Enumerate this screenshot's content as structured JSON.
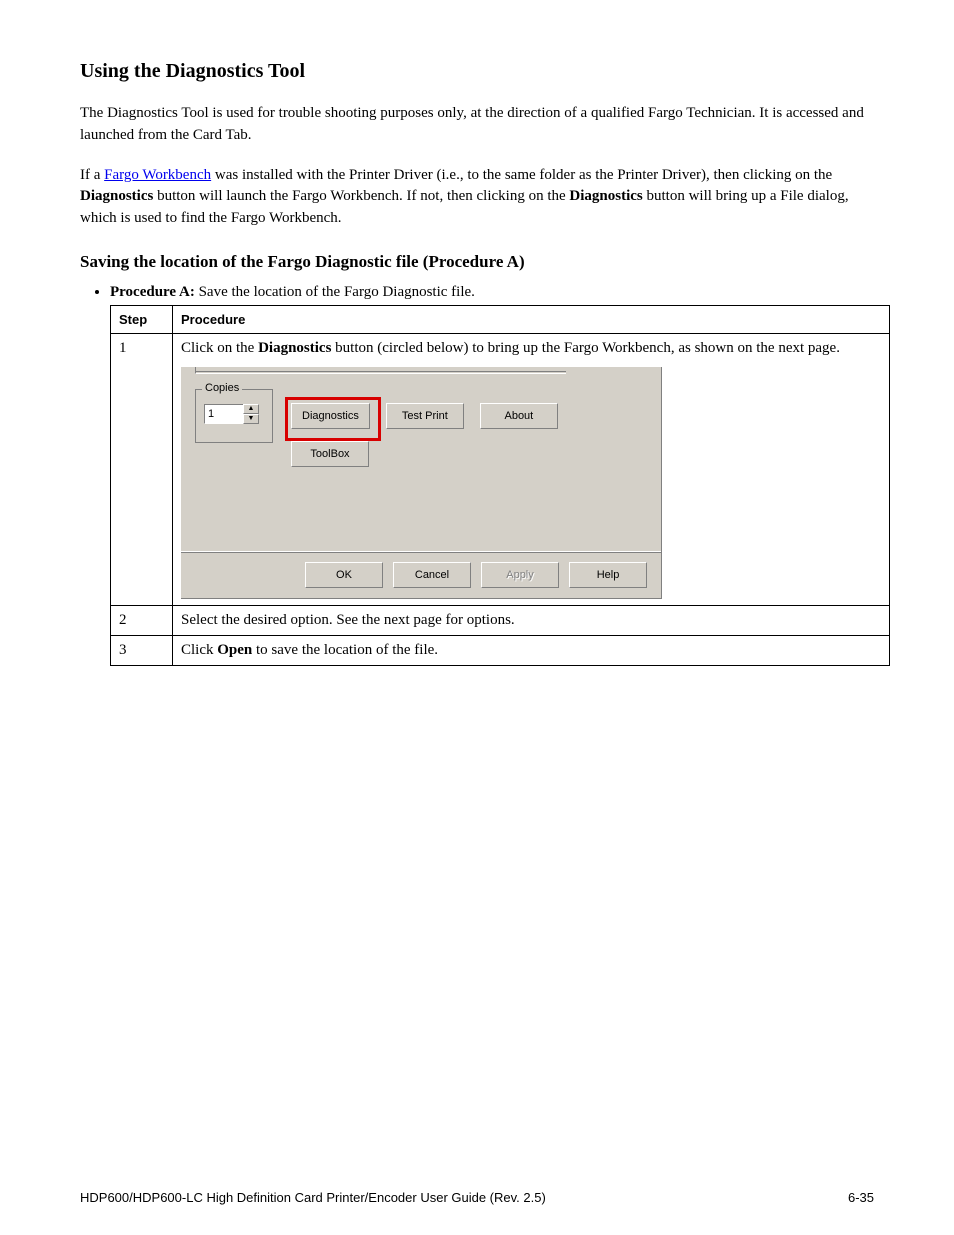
{
  "title": "Using the Diagnostics Tool",
  "paragraphs": {
    "p1": "The Diagnostics Tool is used for trouble shooting purposes only, at the direction of a qualified Fargo Technician. It is accessed and launched from the Card Tab.",
    "p2_prefix": "If a",
    "p2_link": "Fargo Workbench",
    "p2_middle": "was installed with the Printer Driver (i.e., to the same folder as the Printer Driver), then clicking on the",
    "p2_button_ref1": "Diagnostics",
    "p2_after_ref1": "button will launch the Fargo Workbench. If not, then clicking on the",
    "p2_button_ref2": "Diagnostics",
    "p2_after_ref2": "button will bring up a File dialog, which is used to find the Fargo Workbench."
  },
  "section_heading": "Saving the location of the Fargo Diagnostic file (Procedure A)",
  "proc_label": "Procedure A:",
  "proc_text": "Save the location of the Fargo Diagnostic file.",
  "table": {
    "headers": [
      "Step",
      "Procedure"
    ],
    "rows": [
      {
        "num": "1",
        "action_prefix": "Click on the ",
        "action_strong": "Diagnostics",
        "action_suffix": " button (circled below) to bring up the Fargo Workbench, as shown on the next page."
      },
      {
        "num": "2",
        "action": "Select the desired option. See the next page for options."
      },
      {
        "num": "3",
        "action_prefix": "Click ",
        "action_strong": "Open",
        "action_suffix": " to save the location of the file."
      }
    ]
  },
  "dialog": {
    "copies_legend": "Copies",
    "copies_value": "1",
    "buttons": {
      "diagnostics": "Diagnostics",
      "test_print": "Test Print",
      "about": "About",
      "toolbox": "ToolBox",
      "ok": "OK",
      "cancel": "Cancel",
      "apply": "Apply",
      "help": "Help"
    }
  },
  "footer": {
    "left": "HDP600/HDP600-LC High Definition Card Printer/Encoder User Guide (Rev. 2.5)",
    "right": "6-35"
  }
}
